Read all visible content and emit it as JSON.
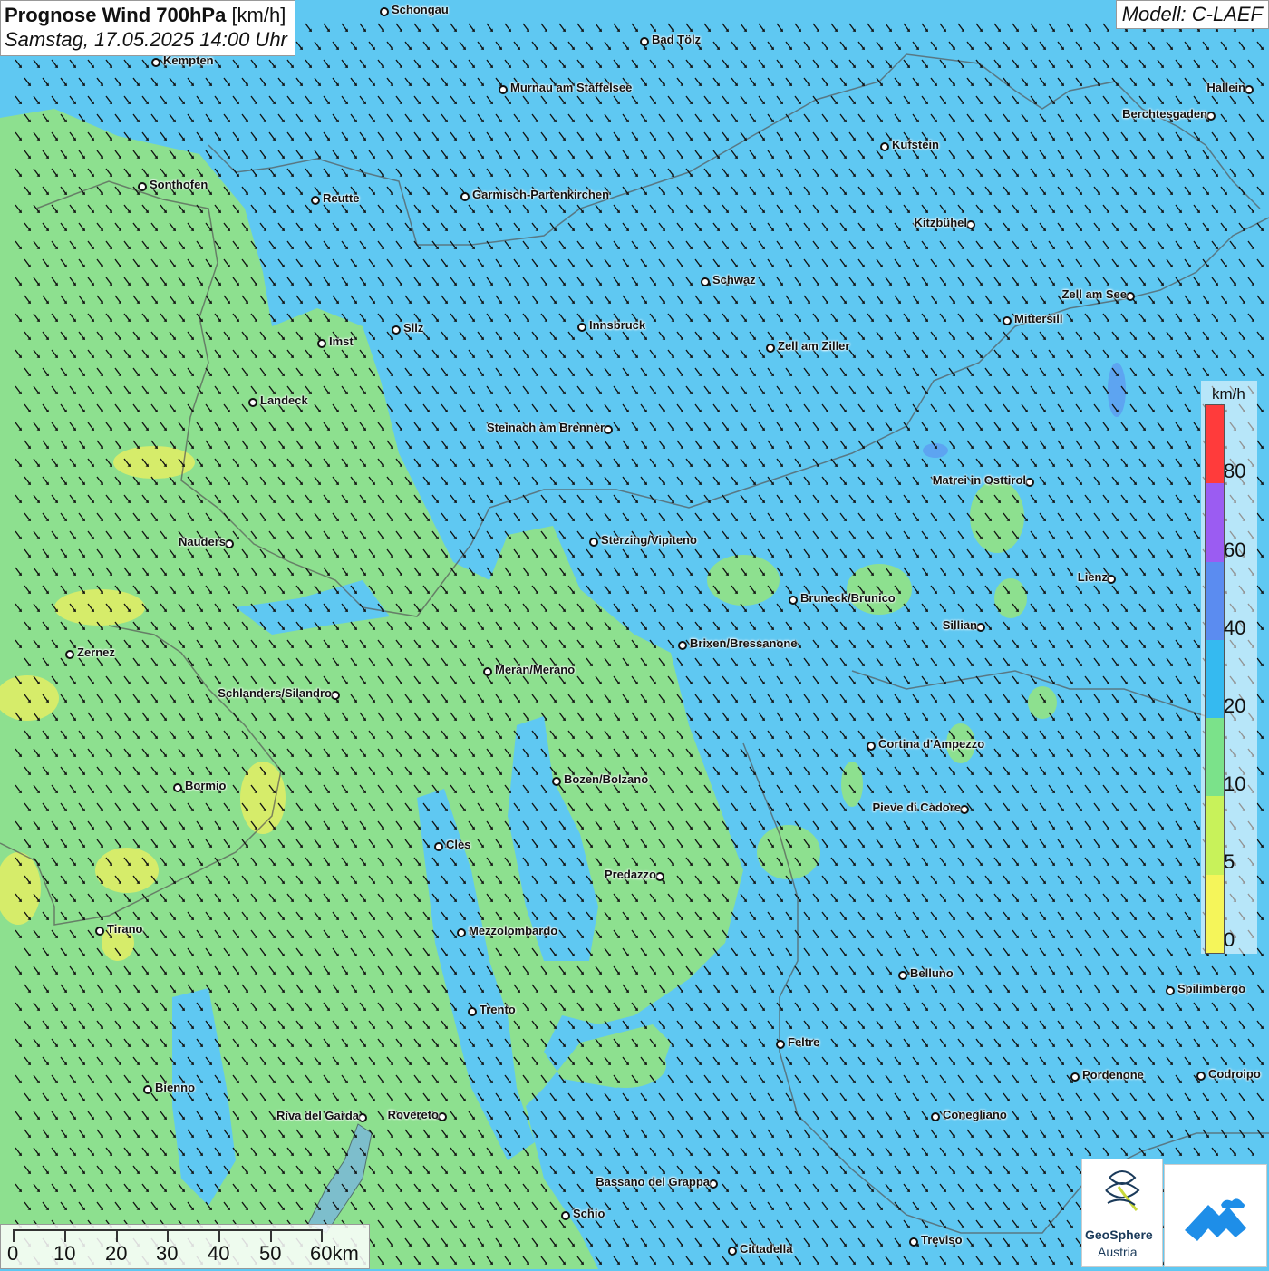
{
  "title": {
    "main": "Prognose Wind 700hPa",
    "unit": "[km/h]",
    "date": "Samstag, 17.05.2025 14:00 Uhr"
  },
  "model": "Modell: C-LAEF",
  "legend": {
    "unit": "km/h",
    "labels": [
      "80",
      "60",
      "40",
      "20",
      "10",
      "5",
      "0"
    ],
    "bands": [
      {
        "from": 80,
        "color": "#ff3b3b"
      },
      {
        "from": 60,
        "color": "#9b5cf2"
      },
      {
        "from": 40,
        "color": "#5b8cf0"
      },
      {
        "from": 20,
        "color": "#35baf0"
      },
      {
        "from": 10,
        "color": "#7be28a"
      },
      {
        "from": 5,
        "color": "#c8f25a"
      },
      {
        "from": 0,
        "color": "#f5f55a"
      }
    ]
  },
  "scale": {
    "labels": [
      "0",
      "10",
      "20",
      "30",
      "40",
      "50",
      "60km"
    ]
  },
  "logos": {
    "geosphere_line1": "GeoSphere",
    "geosphere_line2": "Austria"
  },
  "colors": {
    "wind_low": "#8de08f",
    "wind_mid": "#5fc8f2",
    "wind_high": "#2fb4ef",
    "wind_very_low": "#d6ec6a"
  },
  "cities": [
    {
      "name": "Schongau"
    },
    {
      "name": "Bad Tölz"
    },
    {
      "name": "Kempten"
    },
    {
      "name": "Murnau am Staffelsee"
    },
    {
      "name": "Hallein"
    },
    {
      "name": "Berchtesgaden"
    },
    {
      "name": "Kufstein"
    },
    {
      "name": "Sonthofen"
    },
    {
      "name": "Reutte"
    },
    {
      "name": "Garmisch-Partenkirchen"
    },
    {
      "name": "Kitzbühel"
    },
    {
      "name": "Schwaz"
    },
    {
      "name": "Zell am See"
    },
    {
      "name": "Mittersill"
    },
    {
      "name": "Silz"
    },
    {
      "name": "Innsbruck"
    },
    {
      "name": "Imst"
    },
    {
      "name": "Zell am Ziller"
    },
    {
      "name": "Landeck"
    },
    {
      "name": "Steinach am Brenner"
    },
    {
      "name": "Matrei in Osttirol"
    },
    {
      "name": "Nauders"
    },
    {
      "name": "Sterzing/Vipiteno"
    },
    {
      "name": "Lienz"
    },
    {
      "name": "Bruneck/Brunico"
    },
    {
      "name": "Sillian"
    },
    {
      "name": "Zernez"
    },
    {
      "name": "Brixen/Bressanone"
    },
    {
      "name": "Meran/Merano"
    },
    {
      "name": "Schlanders/Silandro"
    },
    {
      "name": "Cortina d'Ampezzo"
    },
    {
      "name": "Bozen/Bolzano"
    },
    {
      "name": "Bormio"
    },
    {
      "name": "Pieve di Cadore"
    },
    {
      "name": "Cles"
    },
    {
      "name": "Predazzo"
    },
    {
      "name": "Tirano"
    },
    {
      "name": "Mezzolombardo"
    },
    {
      "name": "Belluno"
    },
    {
      "name": "Spilimbergo"
    },
    {
      "name": "Trento"
    },
    {
      "name": "Feltre"
    },
    {
      "name": "Bienno"
    },
    {
      "name": "Pordenone"
    },
    {
      "name": "Codroipo"
    },
    {
      "name": "Riva del Garda"
    },
    {
      "name": "Rovereto"
    },
    {
      "name": "Conegliano"
    },
    {
      "name": "Bassano del Grappa"
    },
    {
      "name": "Schio"
    },
    {
      "name": "Treviso"
    },
    {
      "name": "Cittadella"
    }
  ]
}
